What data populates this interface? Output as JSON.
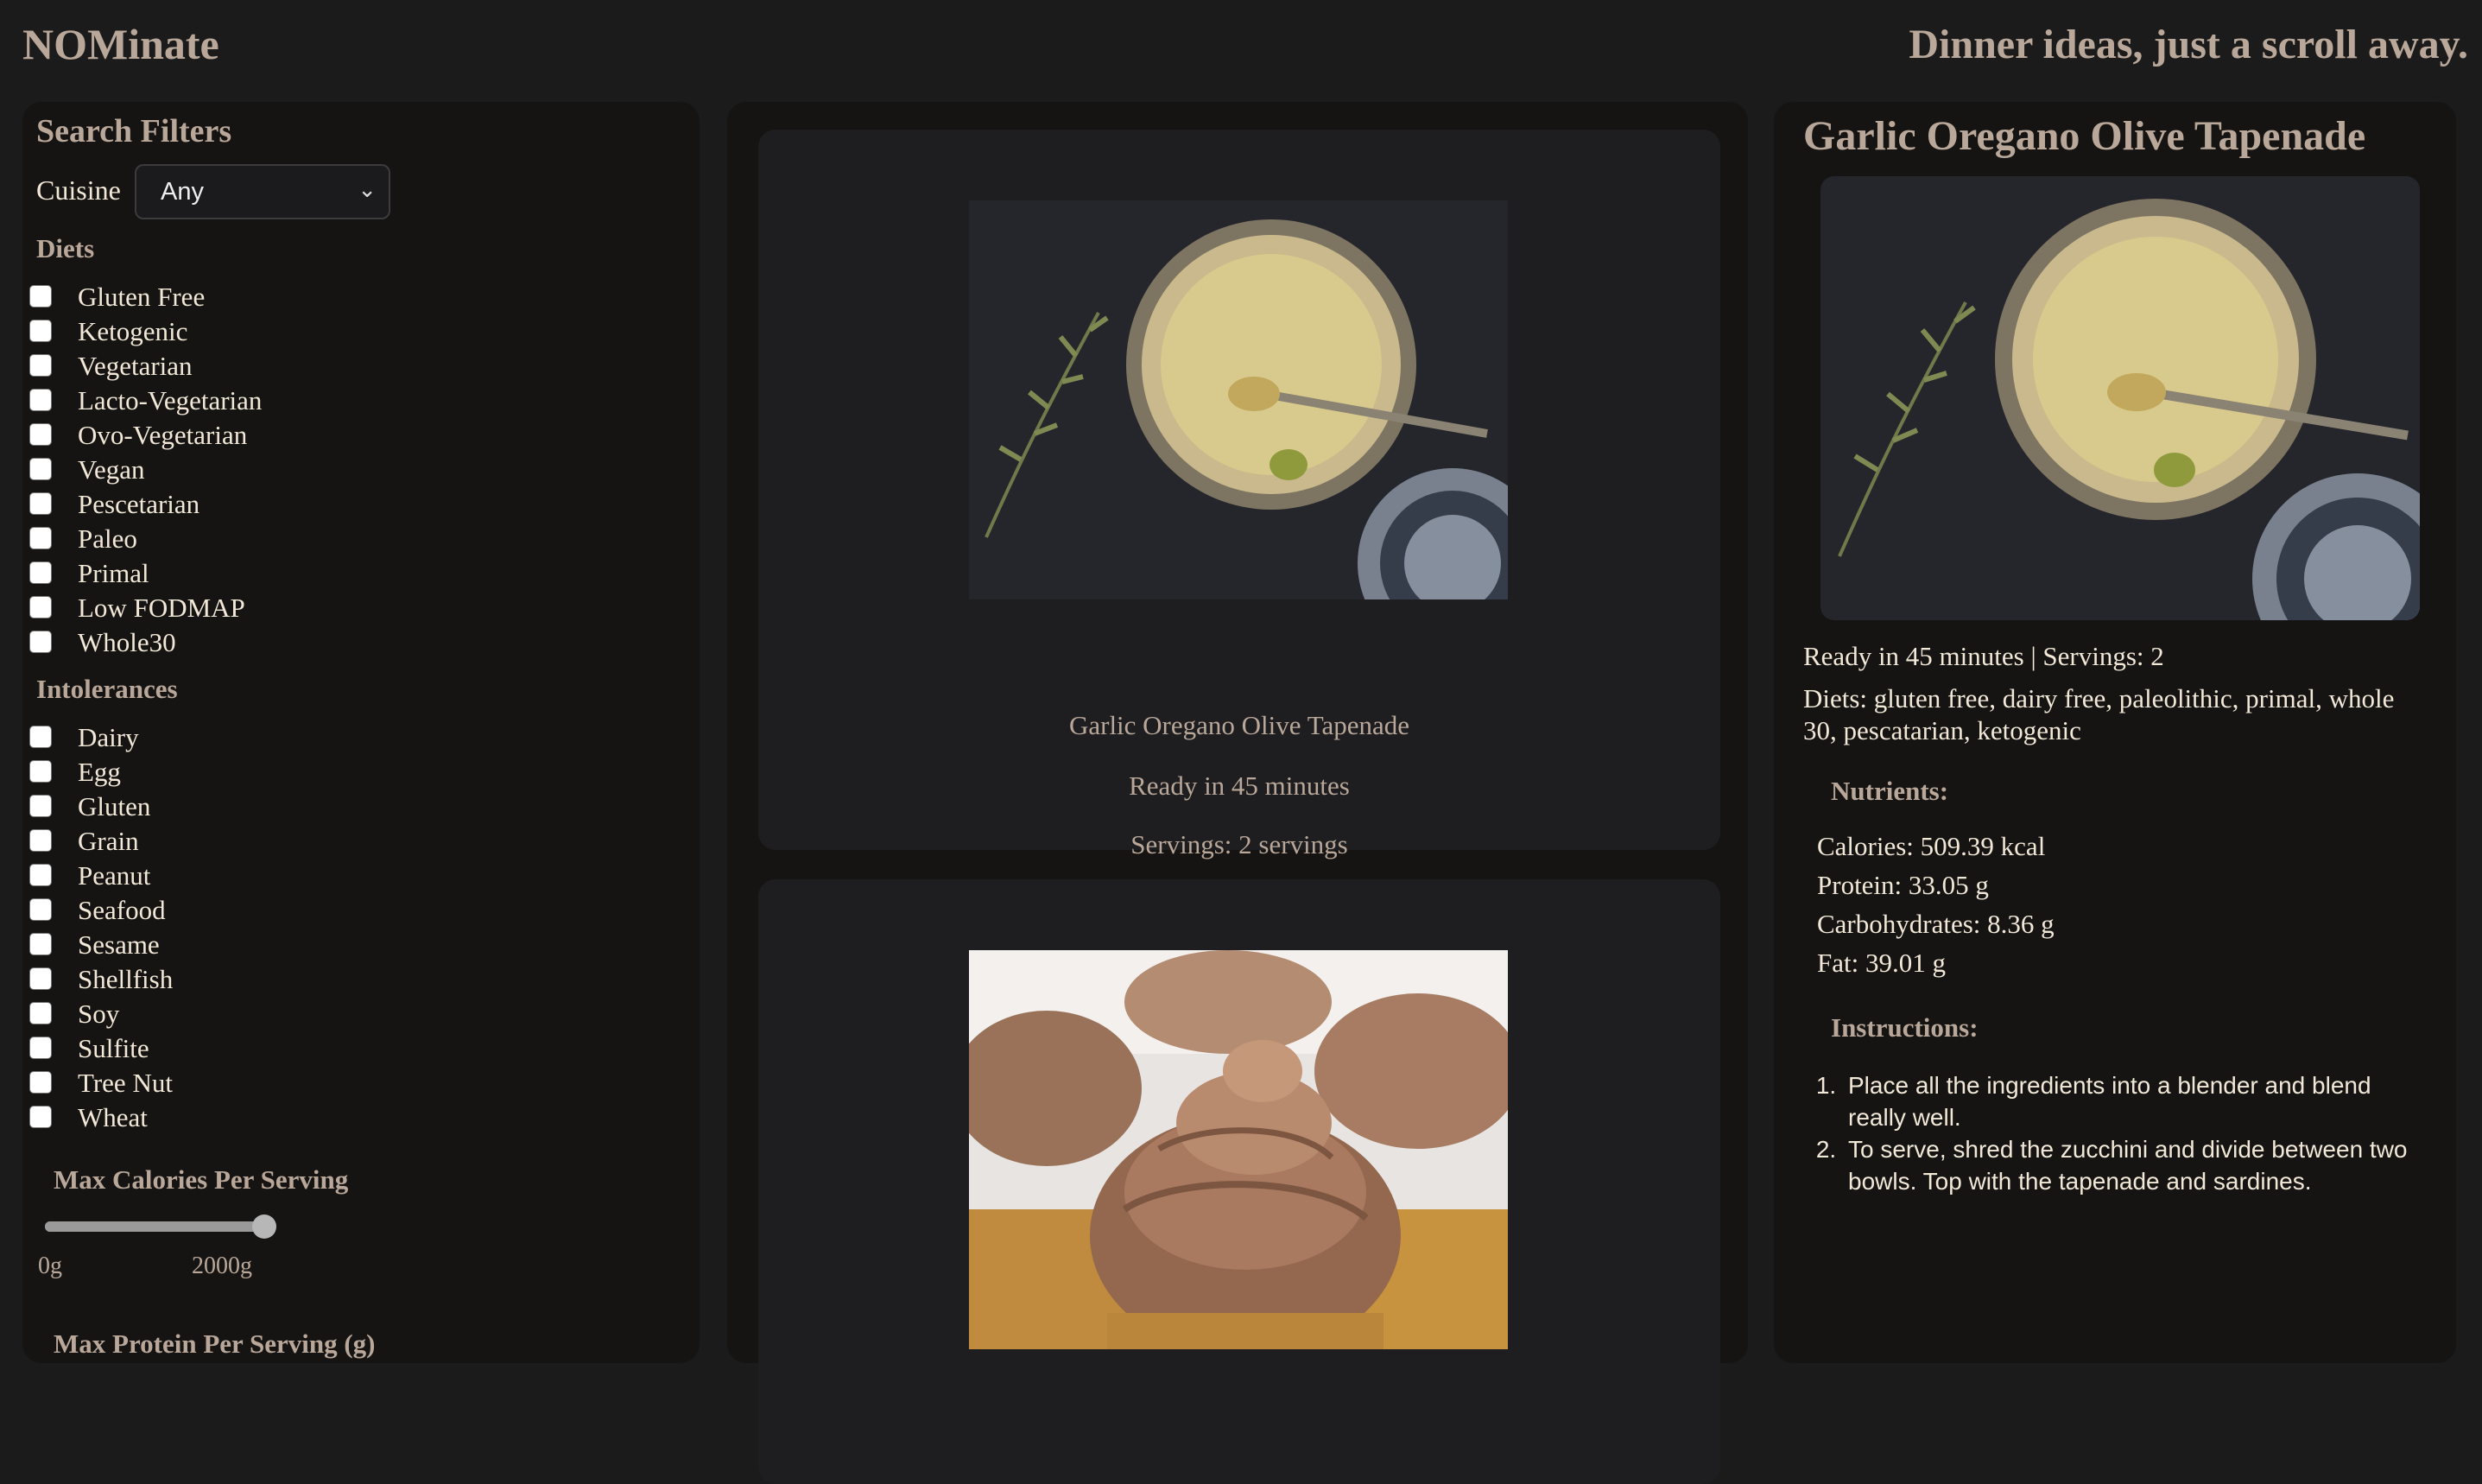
{
  "header": {
    "brand": "NOMinate",
    "tagline": "Dinner ideas, just a scroll away."
  },
  "filters": {
    "title": "Search Filters",
    "cuisine": {
      "label": "Cuisine",
      "selected": "Any"
    },
    "diets": {
      "title": "Diets",
      "options": [
        "Gluten Free",
        "Ketogenic",
        "Vegetarian",
        "Lacto-Vegetarian",
        "Ovo-Vegetarian",
        "Vegan",
        "Pescetarian",
        "Paleo",
        "Primal",
        "Low FODMAP",
        "Whole30"
      ]
    },
    "intolerances": {
      "title": "Intolerances",
      "options": [
        "Dairy",
        "Egg",
        "Gluten",
        "Grain",
        "Peanut",
        "Seafood",
        "Sesame",
        "Shellfish",
        "Soy",
        "Sulfite",
        "Tree Nut",
        "Wheat"
      ]
    },
    "max_calories": {
      "title": "Max Calories Per Serving",
      "min_label": "0g",
      "max_label": "2000g",
      "value_fraction": 1.0
    },
    "next_filter_title": "Max Protein Per Serving (g)"
  },
  "results": [
    {
      "title": "Garlic Oregano Olive Tapenade",
      "ready": "Ready in 45 minutes",
      "servings": "Servings: 2 servings",
      "image": "tapenade-photo"
    },
    {
      "title": "",
      "ready": "",
      "servings": "",
      "image": "cupcake-photo"
    }
  ],
  "detail": {
    "title": "Garlic Oregano Olive Tapenade",
    "image": "tapenade-photo",
    "meta": "Ready in 45 minutes | Servings: 2",
    "diets": "Diets: gluten free, dairy free, paleolithic, primal, whole 30, pescatarian, ketogenic",
    "nutrients_title": "Nutrients:",
    "nutrients": [
      "Calories: 509.39 kcal",
      "Protein: 33.05 g",
      "Carbohydrates: 8.36 g",
      "Fat: 39.01 g"
    ],
    "instructions_title": "Instructions:",
    "instructions": [
      "Place all the ingredients into a blender and blend really well.",
      "To serve, shred the zucchini and divide between two bowls. Top with the tapenade and sardines."
    ]
  },
  "colors": {
    "background": "#1b1b1c",
    "panel": "#151413",
    "card": "#1e1e20",
    "heading": "#b9a89a",
    "text": "#f2e8d8"
  }
}
